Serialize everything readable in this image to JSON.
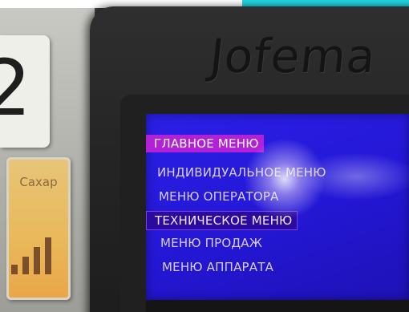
{
  "machine": {
    "brand": "Jofema",
    "slot_number": "2",
    "sugar_label": "Сахар",
    "sugar_level_bars": 4,
    "sugar_level_max": 5
  },
  "display": {
    "title": "ГЛАВНОЕ МЕНЮ",
    "items": [
      {
        "label": "ИНДИВИДУАЛЬНОЕ МЕНЮ",
        "selected": false
      },
      {
        "label": "МЕНЮ ОПЕРАТОРА",
        "selected": false
      },
      {
        "label": "ТЕХНИЧЕСКОЕ МЕНЮ",
        "selected": true
      },
      {
        "label": "МЕНЮ ПРОДАЖ",
        "selected": false
      },
      {
        "label": "МЕНЮ АППАРАТА",
        "selected": false
      }
    ],
    "colors": {
      "screen": "#2417d4",
      "title_highlight": "#b220d8",
      "selection": "#2a0aa0",
      "text": "#d9cff5"
    }
  }
}
